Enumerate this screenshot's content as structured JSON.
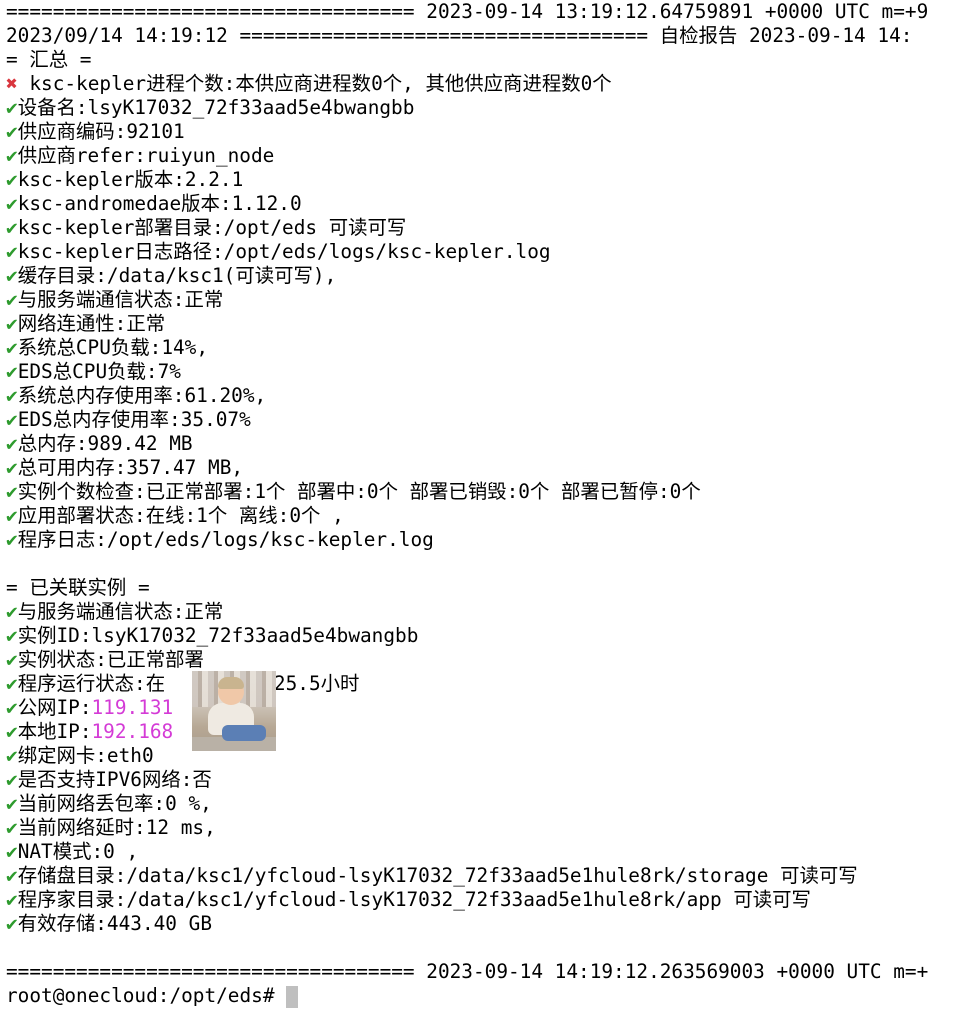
{
  "lines": [
    "=================================== 2023-09-14 13:19:12.64759891 +0000 UTC m=+9",
    "2023/09/14 14:19:12 =================================== 自检报告 2023-09-14 14:",
    "= 汇总 =",
    {
      "mark": "✖",
      "text": " ksc-kepler进程个数:本供应商进程数0个, 其他供应商进程数0个"
    },
    {
      "mark": "✔",
      "text": "设备名:lsyK17032_72f33aad5e4bwangbb"
    },
    {
      "mark": "✔",
      "text": "供应商编码:92101"
    },
    {
      "mark": "✔",
      "text": "供应商refer:ruiyun_node"
    },
    {
      "mark": "✔",
      "text": "ksc-kepler版本:2.2.1"
    },
    {
      "mark": "✔",
      "text": "ksc-andromedae版本:1.12.0"
    },
    {
      "mark": "✔",
      "text": "ksc-kepler部署目录:/opt/eds 可读可写"
    },
    {
      "mark": "✔",
      "text": "ksc-kepler日志路径:/opt/eds/logs/ksc-kepler.log"
    },
    {
      "mark": "✔",
      "text": "缓存目录:/data/ksc1(可读可写),"
    },
    {
      "mark": "✔",
      "text": "与服务端通信状态:正常"
    },
    {
      "mark": "✔",
      "text": "网络连通性:正常"
    },
    {
      "mark": "✔",
      "text": "系统总CPU负载:14%,"
    },
    {
      "mark": "✔",
      "text": "EDS总CPU负载:7%"
    },
    {
      "mark": "✔",
      "text": "系统总内存使用率:61.20%,"
    },
    {
      "mark": "✔",
      "text": "EDS总内存使用率:35.07%"
    },
    {
      "mark": "✔",
      "text": "总内存:989.42 MB"
    },
    {
      "mark": "✔",
      "text": "总可用内存:357.47 MB,"
    },
    {
      "mark": "✔",
      "text": "实例个数检查:已正常部署:1个 部署中:0个 部署已销毁:0个 部署已暂停:0个"
    },
    {
      "mark": "✔",
      "text": "应用部署状态:在线:1个 离线:0个 ,"
    },
    {
      "mark": "✔",
      "text": "程序日志:/opt/eds/logs/ksc-kepler.log"
    },
    "",
    "= 已关联实例 =",
    {
      "mark": "✔",
      "text": "与服务端通信状态:正常"
    },
    {
      "mark": "✔",
      "text": "实例ID:lsyK17032_72f33aad5e4bwangbb"
    },
    {
      "mark": "✔",
      "text": "实例状态:已正常部署"
    },
    {
      "mark": "✔",
      "text": "程序运行状态:在      运行25.5小时"
    },
    {
      "mark": "✔",
      "text": "公网IP:",
      "value": "119.131"
    },
    {
      "mark": "✔",
      "text": "本地IP:",
      "value": "192.168"
    },
    {
      "mark": "✔",
      "text": "绑定网卡:eth0"
    },
    {
      "mark": "✔",
      "text": "是否支持IPV6网络:否"
    },
    {
      "mark": "✔",
      "text": "当前网络丢包率:0 %,"
    },
    {
      "mark": "✔",
      "text": "当前网络延时:12 ms,"
    },
    {
      "mark": "✔",
      "text": "NAT模式:0 ,"
    },
    {
      "mark": "✔",
      "text": "存储盘目录:/data/ksc1/yfcloud-lsyK17032_72f33aad5e1hule8rk/storage 可读可写"
    },
    {
      "mark": "✔",
      "text": "程序家目录:/data/ksc1/yfcloud-lsyK17032_72f33aad5e1hule8rk/app 可读可写"
    },
    {
      "mark": "✔",
      "text": "有效存储:443.40 GB"
    },
    "",
    "=================================== 2023-09-14 14:19:12.263569003 +0000 UTC m=+",
    "root@onecloud:/opt/eds# "
  ],
  "colors": {
    "ok": "#2e9b2e",
    "bad": "#d9363e",
    "highlight": "#d43bd6",
    "background": "#ffffff",
    "text": "#000000"
  }
}
